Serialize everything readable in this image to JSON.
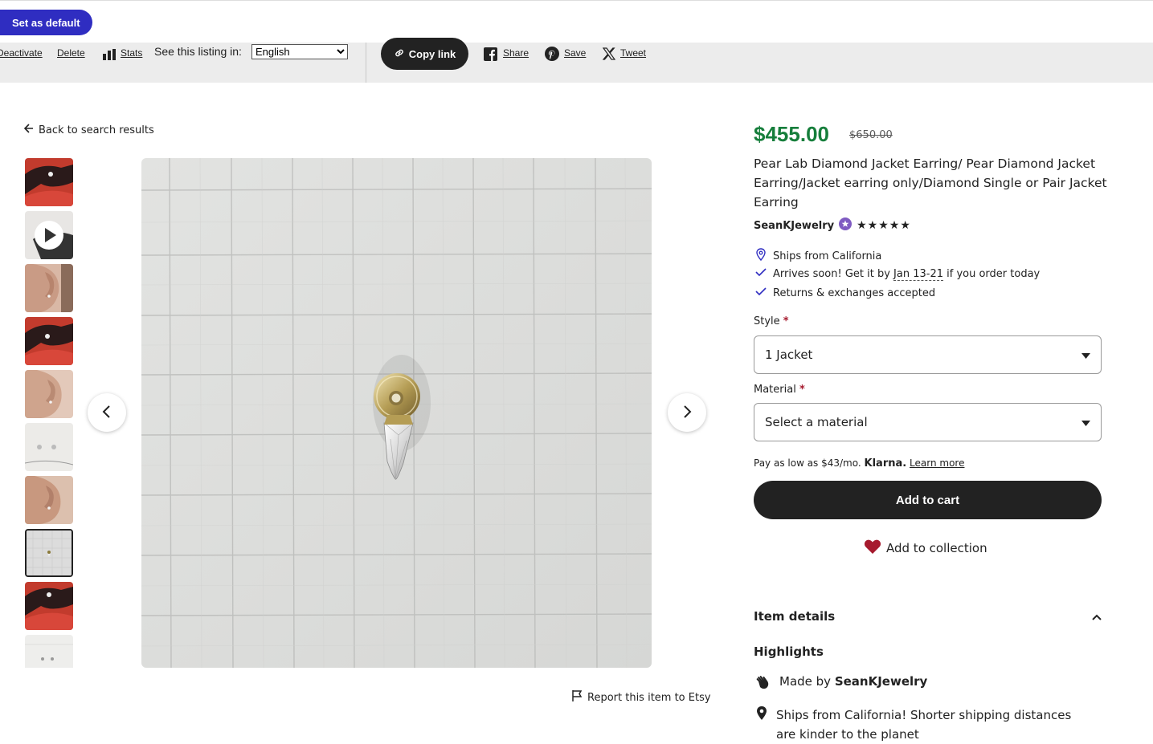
{
  "topbar": {
    "set_default_label": "Set as default"
  },
  "admin": {
    "deactivate": "Deactivate",
    "delete": "Delete",
    "stats": "Stats",
    "see_listing_in": "See this listing in:",
    "language": "English",
    "copy_link": "Copy link",
    "share": "Share",
    "save": "Save",
    "tweet": "Tweet"
  },
  "back_link": "Back to search results",
  "report_link": "Report this item to Etsy",
  "product": {
    "price": "$455.00",
    "original_price": "$650.00",
    "title": "Pear Lab Diamond Jacket Earring/ Pear Diamond Jacket Earring/Jacket earring only/Diamond Single or Pair Jacket Earring",
    "shop_name": "SeanKJewelry",
    "stars": "★★★★★",
    "rating": 5,
    "ships_from": "Ships from California",
    "arrives_prefix": "Arrives soon! Get it by ",
    "arrives_date": "Jan 13-21",
    "arrives_suffix": " if you order today",
    "returns": "Returns & exchanges accepted"
  },
  "options": {
    "style_label": "Style",
    "style_value": "1 Jacket",
    "material_label": "Material",
    "material_value": "Select a material",
    "required_mark": "*"
  },
  "klarna": {
    "prefix": "Pay as low as $43/mo.",
    "brand": "Klarna.",
    "learn_more": "Learn more"
  },
  "actions": {
    "add_to_cart": "Add to cart",
    "add_to_collection": "Add to collection"
  },
  "details": {
    "heading": "Item details",
    "highlights": "Highlights",
    "made_by_prefix": "Made by ",
    "made_by_shop": "SeanKJewelry",
    "ships_note": "Ships from California! Shorter shipping distances are kinder to the planet"
  },
  "colors": {
    "accent": "#2f2dc1",
    "price_green": "#167e3b",
    "heart_red": "#a61a2e",
    "dark": "#222222"
  },
  "thumbnails": [
    "red-jacket-earring",
    "video-thumb",
    "ear-model",
    "red-jacket-earring-2",
    "ear-model-2",
    "pair-on-white",
    "ear-model-3",
    "grid-earring (selected)",
    "red-jacket-earring-3",
    "pair-on-white-2"
  ]
}
